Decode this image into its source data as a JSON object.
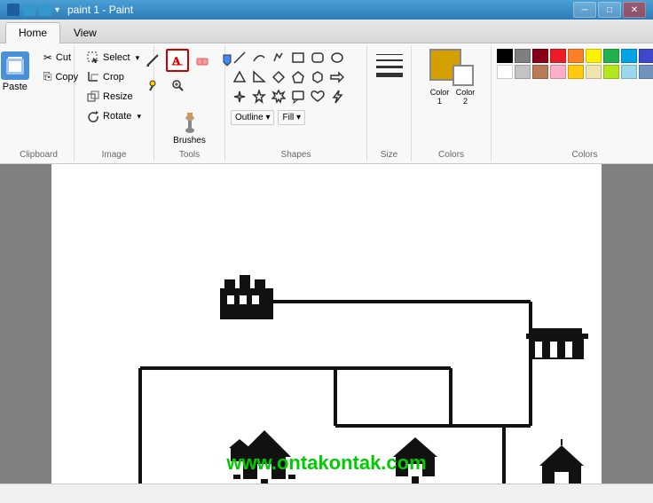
{
  "titleBar": {
    "title": "paint 1 - Paint",
    "minimizeLabel": "─",
    "maximizeLabel": "□",
    "closeLabel": "✕"
  },
  "tabs": [
    {
      "id": "home",
      "label": "Home",
      "active": true
    },
    {
      "id": "view",
      "label": "View",
      "active": false
    }
  ],
  "clipboard": {
    "groupLabel": "Clipboard",
    "paste": "Paste",
    "cut": "Cut",
    "copy": "Copy"
  },
  "image": {
    "groupLabel": "Image",
    "select": "Select",
    "crop": "Crop",
    "resize": "Resize",
    "rotate": "Rotate"
  },
  "tools": {
    "groupLabel": "Tools",
    "brushes": "Brushes"
  },
  "shapes": {
    "groupLabel": "Shapes",
    "outline": "Outline ▾",
    "fill": "Fill ▾"
  },
  "size": {
    "groupLabel": "Size"
  },
  "colors": {
    "groupLabel": "Colors",
    "color1Label": "Color\n1",
    "color2Label": "Color\n2",
    "color1Value": "#d4a000",
    "color2Value": "#ffffff",
    "palette": [
      "#000000",
      "#7f7f7f",
      "#880015",
      "#ed1c24",
      "#ff7f27",
      "#fff200",
      "#22b14c",
      "#00a2e8",
      "#3f48cc",
      "#a349a4",
      "#ffffff",
      "#c3c3c3",
      "#b97a57",
      "#ffaec9",
      "#ffc90e",
      "#efe4b0",
      "#b5e61d",
      "#99d9ea",
      "#7092be",
      "#c8bfe7"
    ]
  },
  "watermark": "www.ontakontak.com",
  "status": ""
}
